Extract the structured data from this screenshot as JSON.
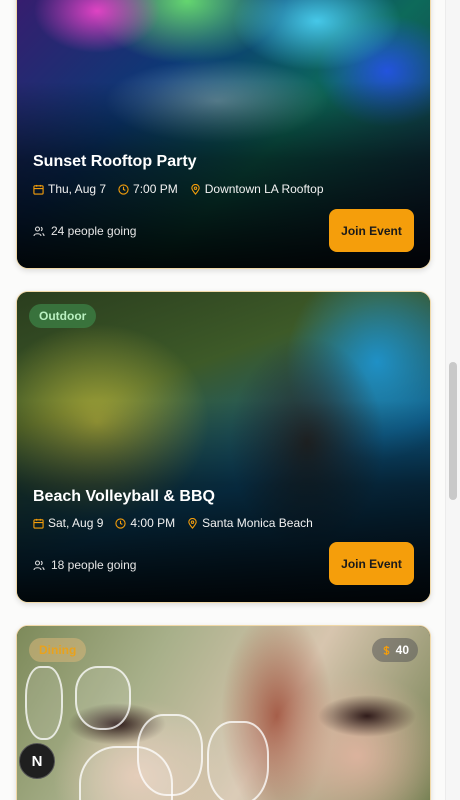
{
  "events": [
    {
      "title": "Sunset Rooftop Party",
      "date": "Thu, Aug 7",
      "time": "7:00 PM",
      "location": "Downtown LA Rooftop",
      "going": "24 people going",
      "button": "Join Event"
    },
    {
      "category": "Outdoor",
      "title": "Beach Volleyball & BBQ",
      "date": "Sat, Aug 9",
      "time": "4:00 PM",
      "location": "Santa Monica Beach",
      "going": "18 people going",
      "button": "Join Event"
    },
    {
      "category": "Dining",
      "price": "40"
    }
  ],
  "fab": {
    "label": "N"
  },
  "colors": {
    "accent": "#f59e0b",
    "badge_outdoor": "#3c8246",
    "badge_dining_text": "#e8a21e"
  },
  "icons": [
    "calendar-icon",
    "clock-icon",
    "location-pin-icon",
    "users-icon",
    "dollar-icon"
  ]
}
